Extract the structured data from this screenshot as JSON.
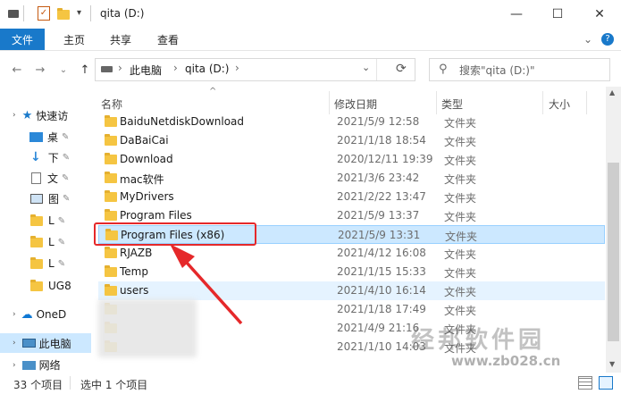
{
  "window": {
    "title": "qita (D:)",
    "minimize_glyph": "—",
    "maximize_glyph": "☐",
    "close_glyph": "✕"
  },
  "ribbon": {
    "tabs": [
      "文件",
      "主页",
      "共享",
      "查看"
    ],
    "expand_glyph": "⌄",
    "help_glyph": "?"
  },
  "nav": {
    "back_icon": "←",
    "forward_icon": "→",
    "recent_icon": "⌄",
    "up_icon": "↑"
  },
  "address": {
    "segments": [
      "此电脑",
      "qita (D:)"
    ],
    "refresh_icon": "⟳"
  },
  "search": {
    "placeholder": "搜索\"qita (D:)\""
  },
  "sidebar": {
    "items": [
      {
        "label": "快速访",
        "icon": "star-icon"
      },
      {
        "label": "桌",
        "icon": "desktop-icon"
      },
      {
        "label": "下",
        "icon": "download-icon"
      },
      {
        "label": "文",
        "icon": "document-icon"
      },
      {
        "label": "图",
        "icon": "picture-icon"
      },
      {
        "label": "L",
        "icon": "folder-icon"
      },
      {
        "label": "L",
        "icon": "folder-icon"
      },
      {
        "label": "L",
        "icon": "folder-icon"
      },
      {
        "label": "UG8",
        "icon": "folder-icon"
      },
      {
        "label": "OneD",
        "icon": "cloud-icon"
      },
      {
        "label": "此电脑",
        "icon": "pc-icon"
      },
      {
        "label": "网络",
        "icon": "network-icon"
      }
    ]
  },
  "columns": {
    "name": "名称",
    "date": "修改日期",
    "type": "类型",
    "size": "大小"
  },
  "files": [
    {
      "name": "BaiduNetdiskDownload",
      "date": "2021/5/9 12:58",
      "type": "文件夹"
    },
    {
      "name": "DaBaiCai",
      "date": "2021/1/18 18:54",
      "type": "文件夹"
    },
    {
      "name": "Download",
      "date": "2020/12/11 19:39",
      "type": "文件夹"
    },
    {
      "name": "mac软件",
      "date": "2021/3/6 23:42",
      "type": "文件夹"
    },
    {
      "name": "MyDrivers",
      "date": "2021/2/22 13:47",
      "type": "文件夹"
    },
    {
      "name": "Program Files",
      "date": "2021/5/9 13:37",
      "type": "文件夹"
    },
    {
      "name": "Program Files (x86)",
      "date": "2021/5/9 13:31",
      "type": "文件夹",
      "state": "selected"
    },
    {
      "name": "RJAZB",
      "date": "2021/4/12 16:08",
      "type": "文件夹"
    },
    {
      "name": "Temp",
      "date": "2021/1/15 15:33",
      "type": "文件夹"
    },
    {
      "name": "users",
      "date": "2021/4/10 16:14",
      "type": "文件夹",
      "state": "hover"
    },
    {
      "name": "",
      "date": "2021/1/18 17:49",
      "type": "文件夹"
    },
    {
      "name": "",
      "date": "2021/4/9 21:16",
      "type": "文件夹"
    },
    {
      "name": "",
      "date": "2021/1/10 14:03",
      "type": "文件夹"
    }
  ],
  "status": {
    "count": "33 个项目",
    "selected": "选中 1 个项目"
  },
  "watermark": {
    "line1": "经邦软件园",
    "line2": "www.zb028.cn"
  },
  "colors": {
    "accent": "#1979ca",
    "selection": "#cce8ff",
    "highlight": "#e5282a",
    "folder": "#f5c542"
  }
}
